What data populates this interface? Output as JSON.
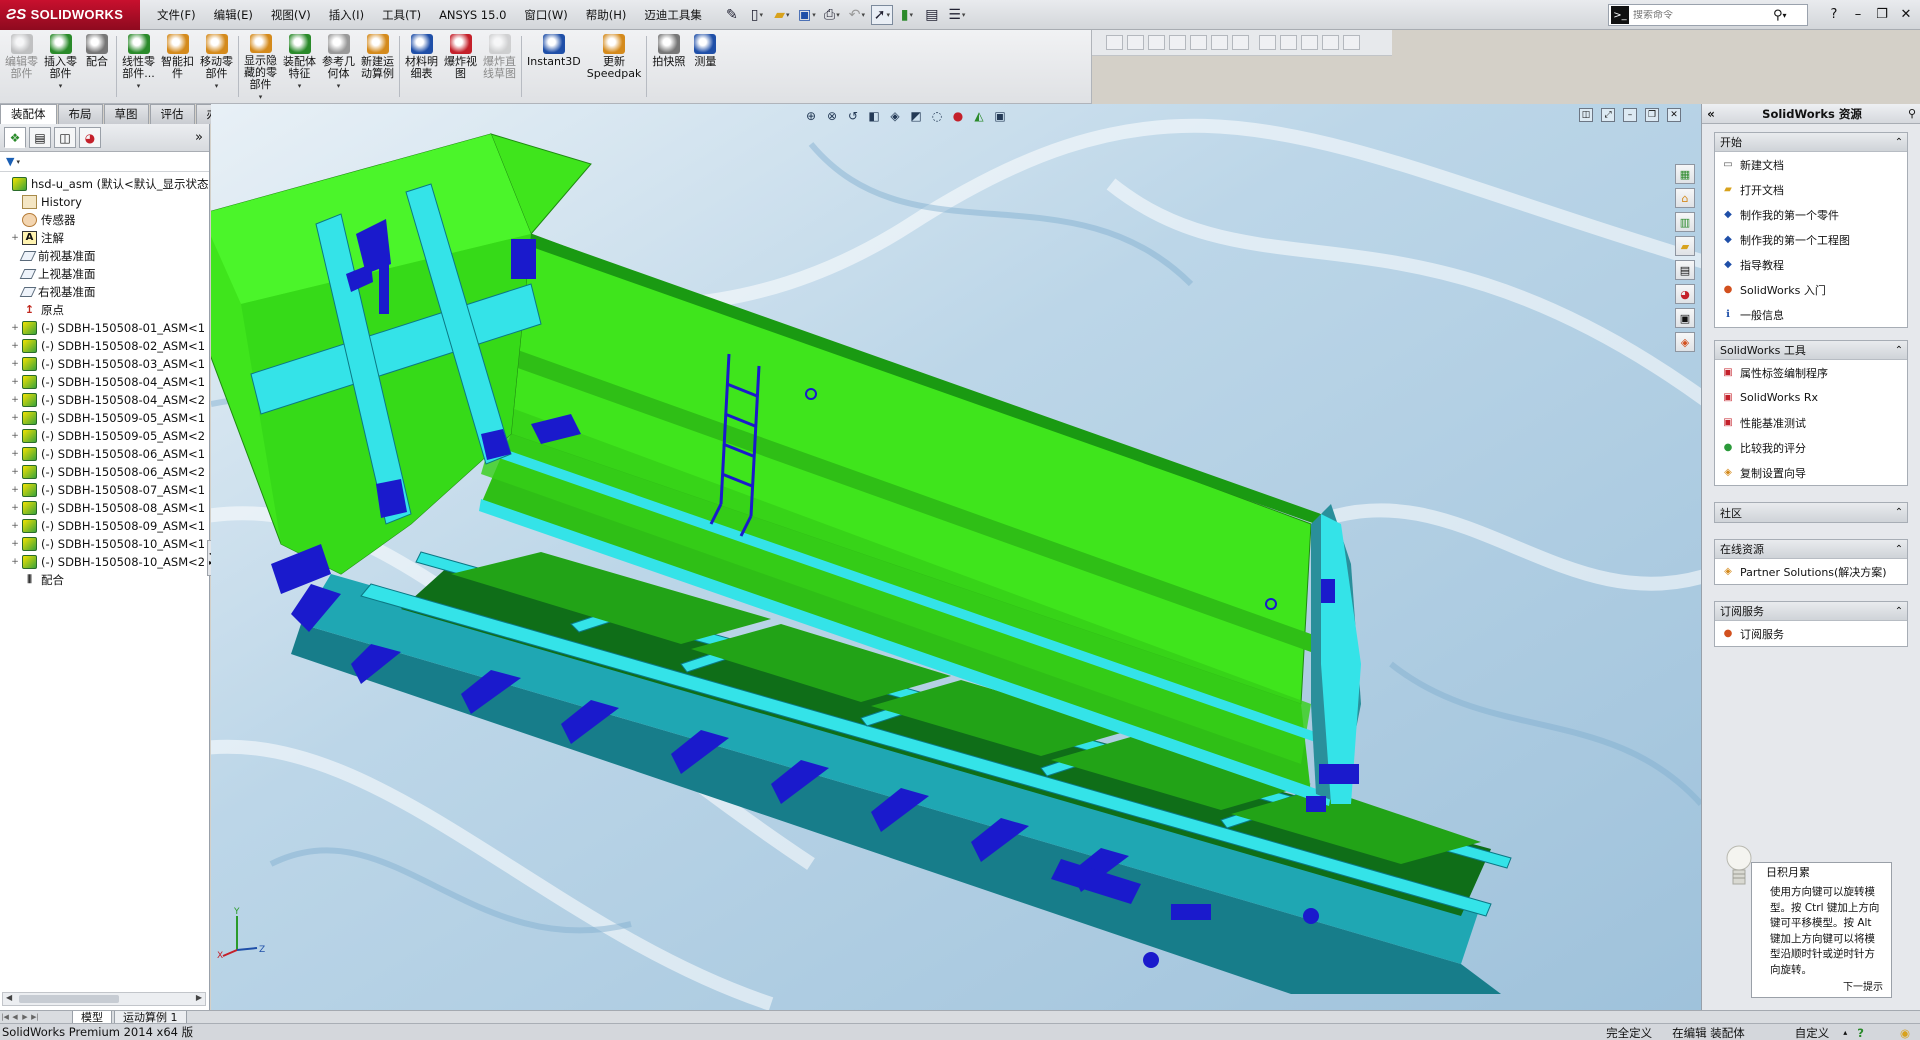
{
  "titlebar": {
    "logo": "SOLIDWORKS",
    "menu": [
      "文件(F)",
      "编辑(E)",
      "视图(V)",
      "插入(I)",
      "工具(T)",
      "ANSYS 15.0",
      "窗口(W)",
      "帮助(H)",
      "迈迪工具集"
    ],
    "search_placeholder": "搜索命令"
  },
  "commandmanager": {
    "buttons": [
      {
        "label": "编辑零\n部件",
        "icon": "edit-component-icon",
        "disabled": true
      },
      {
        "label": "插入零\n部件",
        "icon": "insert-component-icon",
        "disabled": false
      },
      {
        "label": "配合",
        "icon": "mate-icon",
        "disabled": false
      },
      {
        "label": "线性零\n部件...",
        "icon": "linear-pattern-icon",
        "disabled": false
      },
      {
        "label": "智能扣\n件",
        "icon": "smart-fasteners-icon",
        "disabled": false
      },
      {
        "label": "移动零\n部件",
        "icon": "move-component-icon",
        "disabled": false
      },
      {
        "label": "显示隐\n藏的零\n部件",
        "icon": "show-hidden-icon",
        "disabled": false
      },
      {
        "label": "装配体\n特征",
        "icon": "assembly-feature-icon",
        "disabled": false
      },
      {
        "label": "参考几\n何体",
        "icon": "reference-geometry-icon",
        "disabled": false
      },
      {
        "label": "新建运\n动算例",
        "icon": "motion-study-icon",
        "disabled": false
      },
      {
        "label": "材料明\n细表",
        "icon": "bom-icon",
        "disabled": false
      },
      {
        "label": "爆炸视\n图",
        "icon": "exploded-view-icon",
        "disabled": false
      },
      {
        "label": "爆炸直\n线草图",
        "icon": "explode-line-icon",
        "disabled": true
      },
      {
        "label": "Instant3D",
        "icon": "instant3d-icon",
        "disabled": false
      },
      {
        "label": "更新\nSpeedpak",
        "icon": "speedpak-icon",
        "disabled": false
      },
      {
        "label": "拍快照",
        "icon": "snapshot-icon",
        "disabled": false
      },
      {
        "label": "测量",
        "icon": "measure-icon",
        "disabled": false
      }
    ],
    "tabs": [
      "装配体",
      "布局",
      "草图",
      "评估",
      "办公室产品"
    ]
  },
  "featuretree": {
    "root": "hsd-u_asm (默认<默认_显示状态",
    "items": [
      {
        "label": "History",
        "icon": "history-icon",
        "kind": "hist",
        "exp": ""
      },
      {
        "label": "传感器",
        "icon": "sensor-icon",
        "kind": "sensor",
        "exp": ""
      },
      {
        "label": "注解",
        "icon": "annotation-icon",
        "kind": "annot",
        "exp": "+"
      },
      {
        "label": "前视基准面",
        "icon": "plane-icon",
        "kind": "plane",
        "exp": ""
      },
      {
        "label": "上视基准面",
        "icon": "plane-icon",
        "kind": "plane",
        "exp": ""
      },
      {
        "label": "右视基准面",
        "icon": "plane-icon",
        "kind": "plane",
        "exp": ""
      },
      {
        "label": "原点",
        "icon": "origin-icon",
        "kind": "origin",
        "exp": ""
      },
      {
        "label": "(-) SDBH-150508-01_ASM<1",
        "icon": "subassembly-icon",
        "kind": "part",
        "exp": "+"
      },
      {
        "label": "(-) SDBH-150508-02_ASM<1",
        "icon": "subassembly-icon",
        "kind": "part",
        "exp": "+"
      },
      {
        "label": "(-) SDBH-150508-03_ASM<1",
        "icon": "subassembly-icon",
        "kind": "part",
        "exp": "+"
      },
      {
        "label": "(-) SDBH-150508-04_ASM<1",
        "icon": "subassembly-icon",
        "kind": "part",
        "exp": "+"
      },
      {
        "label": "(-) SDBH-150508-04_ASM<2",
        "icon": "subassembly-icon",
        "kind": "part",
        "exp": "+"
      },
      {
        "label": "(-) SDBH-150509-05_ASM<1",
        "icon": "subassembly-icon",
        "kind": "part",
        "exp": "+"
      },
      {
        "label": "(-) SDBH-150509-05_ASM<2",
        "icon": "subassembly-icon",
        "kind": "part",
        "exp": "+"
      },
      {
        "label": "(-) SDBH-150508-06_ASM<1",
        "icon": "subassembly-icon",
        "kind": "part",
        "exp": "+"
      },
      {
        "label": "(-) SDBH-150508-06_ASM<2",
        "icon": "subassembly-icon",
        "kind": "part",
        "exp": "+"
      },
      {
        "label": "(-) SDBH-150508-07_ASM<1",
        "icon": "subassembly-icon",
        "kind": "part",
        "exp": "+"
      },
      {
        "label": "(-) SDBH-150508-08_ASM<1",
        "icon": "subassembly-icon",
        "kind": "part",
        "exp": "+"
      },
      {
        "label": "(-) SDBH-150508-09_ASM<1",
        "icon": "subassembly-icon",
        "kind": "part",
        "exp": "+"
      },
      {
        "label": "(-) SDBH-150508-10_ASM<1",
        "icon": "subassembly-icon",
        "kind": "part",
        "exp": "+"
      },
      {
        "label": "(-) SDBH-150508-10_ASM<2",
        "icon": "subassembly-icon",
        "kind": "part",
        "exp": "+"
      },
      {
        "label": "配合",
        "icon": "mates-icon",
        "kind": "mate",
        "exp": ""
      }
    ]
  },
  "taskpane": {
    "title": "SolidWorks 资源",
    "sections": [
      {
        "title": "开始",
        "collapsed": false,
        "items": [
          {
            "label": "新建文档",
            "icon": "new-document-icon",
            "glyph": "▭",
            "color": "#555"
          },
          {
            "label": "打开文档",
            "icon": "open-folder-icon",
            "glyph": "▰",
            "color": "#d8a21c"
          },
          {
            "label": "制作我的第一个零件",
            "icon": "tutorial-icon",
            "glyph": "◆",
            "color": "#1f4fa8"
          },
          {
            "label": "制作我的第一个工程图",
            "icon": "tutorial-icon",
            "glyph": "◆",
            "color": "#1f4fa8"
          },
          {
            "label": "指导教程",
            "icon": "tutorial-icon",
            "glyph": "◆",
            "color": "#1f4fa8"
          },
          {
            "label": "SolidWorks 入门",
            "icon": "intro-icon",
            "glyph": "●",
            "color": "#d2501e"
          },
          {
            "label": "一般信息",
            "icon": "info-icon",
            "glyph": "ℹ",
            "color": "#1f4fa8"
          }
        ]
      },
      {
        "title": "SolidWorks 工具",
        "collapsed": false,
        "items": [
          {
            "label": "属性标签编制程序",
            "icon": "property-tab-icon",
            "glyph": "▣",
            "color": "#c4202a"
          },
          {
            "label": "SolidWorks Rx",
            "icon": "rx-icon",
            "glyph": "▣",
            "color": "#c4202a"
          },
          {
            "label": "性能基准测试",
            "icon": "benchmark-icon",
            "glyph": "▣",
            "color": "#c4202a"
          },
          {
            "label": "比较我的评分",
            "icon": "compare-score-icon",
            "glyph": "●",
            "color": "#2b9a3a"
          },
          {
            "label": "复制设置向导",
            "icon": "copy-settings-icon",
            "glyph": "◈",
            "color": "#d48a1c"
          }
        ]
      },
      {
        "title": "社区",
        "collapsed": true,
        "items": []
      },
      {
        "title": "在线资源",
        "collapsed": false,
        "items": [
          {
            "label": "Partner Solutions(解决方案)",
            "icon": "partner-icon",
            "glyph": "◈",
            "color": "#d48a1c"
          }
        ]
      },
      {
        "title": "订阅服务",
        "collapsed": false,
        "items": [
          {
            "label": "订阅服务",
            "icon": "subscription-icon",
            "glyph": "●",
            "color": "#d2501e"
          }
        ]
      }
    ]
  },
  "tip": {
    "title": "日积月累",
    "body": "使用方向键可以旋转模型。按 Ctrl 键加上方向键可平移模型。按 Alt 键加上方向键可以将模型沿顺时针或逆时针方向旋转。",
    "next": "下一提示"
  },
  "bottomtabs": [
    "模型",
    "运动算例 1"
  ],
  "statusbar": {
    "app": "SolidWorks Premium 2014 x64 版",
    "state": "完全定义",
    "mode": "在编辑 装配体",
    "units": "自定义"
  },
  "colors": {
    "body_green": "#3fe51c",
    "floor_green": "#1f8a12",
    "frame_cyan": "#34e3e8",
    "bracket_blue": "#1a1acc"
  }
}
